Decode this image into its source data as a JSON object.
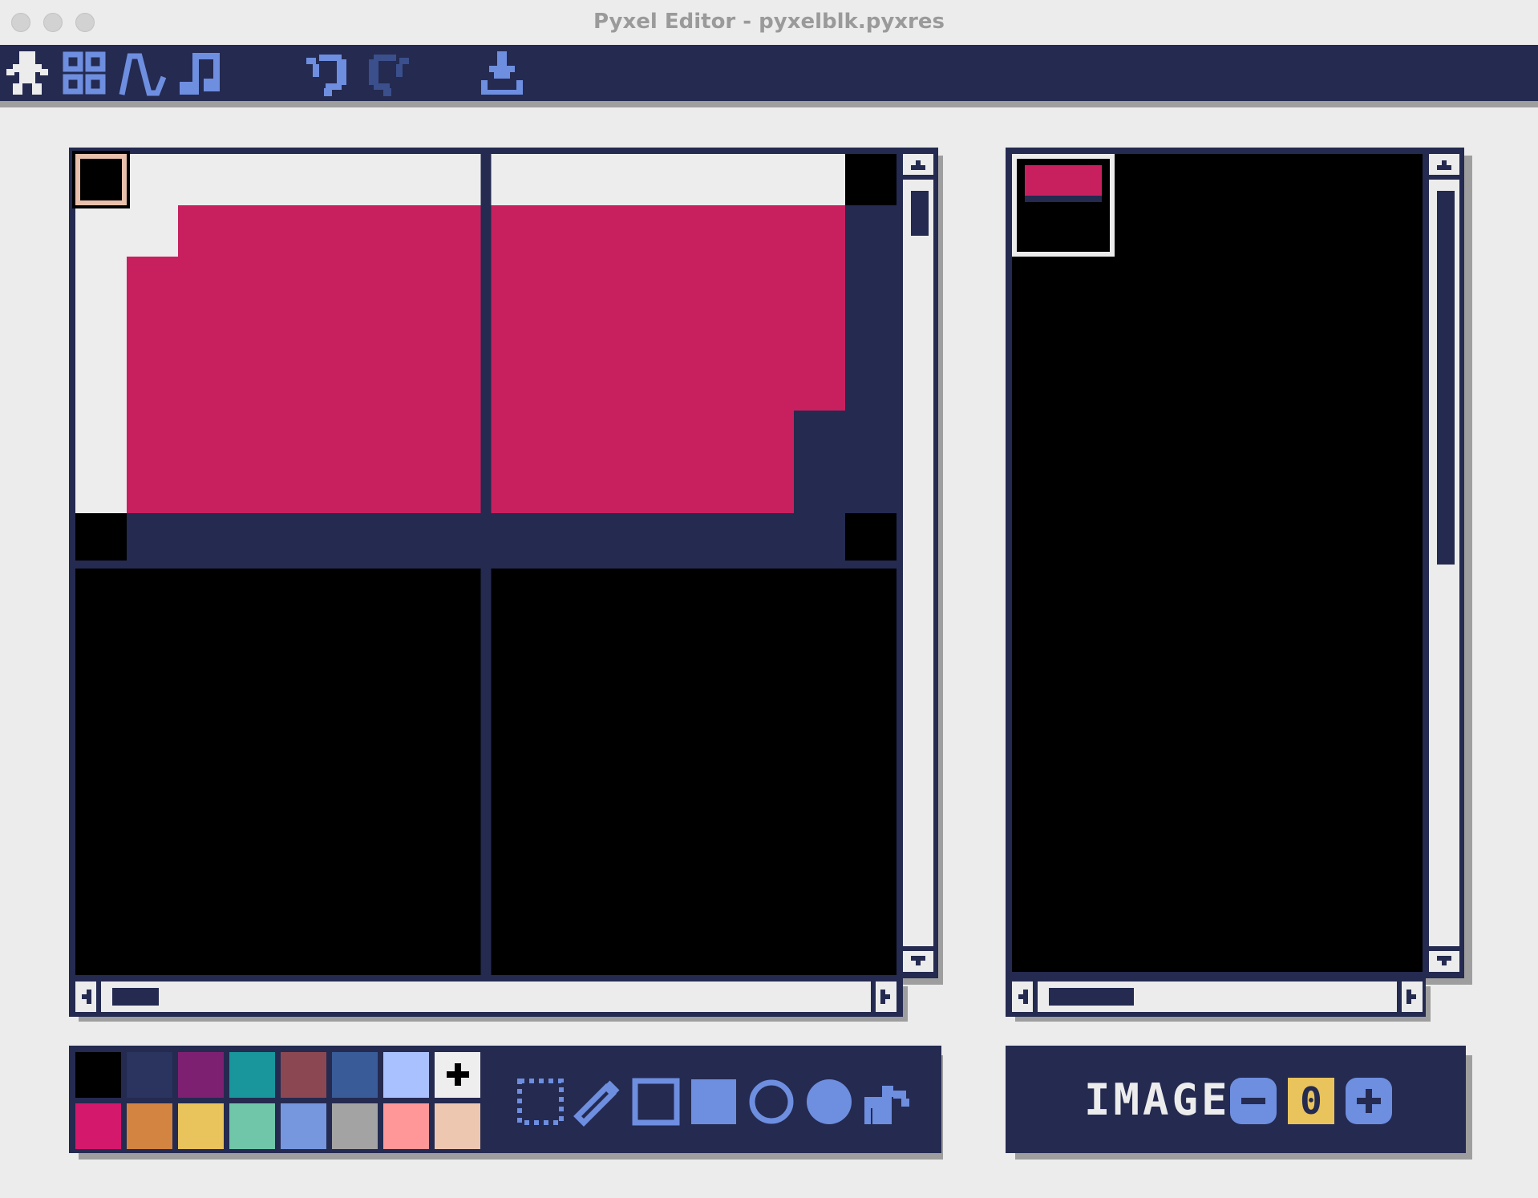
{
  "window": {
    "title": "Pyxel Editor - pyxelblk.pyxres"
  },
  "toolbar": {
    "icons": [
      "sprite-editor-icon",
      "tilemap-editor-icon",
      "sound-editor-icon",
      "music-editor-icon",
      "undo-icon",
      "redo-icon",
      "save-icon"
    ]
  },
  "colors": {
    "navy": "#242a50",
    "pink": "#c8205f",
    "canvas_light": "#ededed",
    "frame_bg": "#ececec",
    "accent_blue": "#6e8ee0",
    "selection_peach": "#e8c0ab"
  },
  "palette": {
    "row1": [
      "#000000",
      "#2b335f",
      "#7e2072",
      "#19959c",
      "#8b4852",
      "#395c98",
      "#a9c1ff",
      "#eeeeee"
    ],
    "row2": [
      "#d4186c",
      "#d38441",
      "#e9c35b",
      "#70c6a9",
      "#7696de",
      "#a3a3a3",
      "#ff9798",
      "#edc7b0"
    ],
    "selected_index": 7
  },
  "tools": [
    "select-tool-icon",
    "pen-tool-icon",
    "rect-outline-tool-icon",
    "rect-fill-tool-icon",
    "circle-outline-tool-icon",
    "circle-fill-tool-icon",
    "bucket-fill-tool-icon"
  ],
  "image_panel": {
    "label": "IMAGE",
    "value": "0"
  }
}
